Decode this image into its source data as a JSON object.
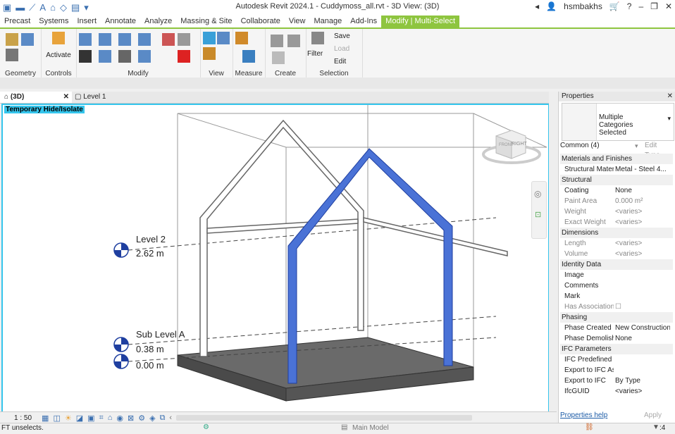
{
  "titlebar": {
    "title": "Autodesk Revit 2024.1 - Cuddymoss_all.rvt - 3D View: (3D)",
    "user": "hsmbakhs"
  },
  "tabs": [
    "Precast",
    "Systems",
    "Insert",
    "Annotate",
    "Analyze",
    "Massing & Site",
    "Collaborate",
    "View",
    "Manage",
    "Add-Ins",
    "Modify | Multi-Select"
  ],
  "ribbon": {
    "panels": [
      "Geometry",
      "Controls",
      "Modify",
      "View",
      "Measure",
      "Create",
      "Selection"
    ],
    "activate_label": "Activate",
    "filter_label": "Filter",
    "save_label": "Save",
    "load_label": "Load",
    "edit_label": "Edit"
  },
  "viewtabs": [
    "(3D)",
    "Level 1"
  ],
  "canvas": {
    "temp_hide": "Temporary Hide/Isolate",
    "levels": [
      {
        "name": "Level 2",
        "elev": "2.62 m"
      },
      {
        "name": "Sub Level A",
        "elev": "0.38 m"
      },
      {
        "name": "",
        "elev": "0.00 m"
      }
    ],
    "viewcube_faces": [
      "FRONT",
      "RIGHT"
    ]
  },
  "viewbar": {
    "scale": "1 : 50"
  },
  "status": {
    "text": "FT unselects.",
    "model": "Main Model",
    "filter_count": ":4"
  },
  "properties": {
    "title": "Properties",
    "type_name": "Multiple Categories Selected",
    "filter": "Common (4)",
    "edit_type": "Edit Type",
    "sections": [
      {
        "name": "Materials and Finishes",
        "rows": [
          {
            "k": "Structural Mater...",
            "v": "Metal - Steel 4...",
            "dim": false
          }
        ]
      },
      {
        "name": "Structural",
        "rows": [
          {
            "k": "Coating",
            "v": "None",
            "dim": false
          },
          {
            "k": "Paint Area",
            "v": "0.000 m²",
            "dim": true
          },
          {
            "k": "Weight",
            "v": "<varies>",
            "dim": true
          },
          {
            "k": "Exact Weight",
            "v": "<varies>",
            "dim": true
          }
        ]
      },
      {
        "name": "Dimensions",
        "rows": [
          {
            "k": "Length",
            "v": "<varies>",
            "dim": true
          },
          {
            "k": "Volume",
            "v": "<varies>",
            "dim": true
          }
        ]
      },
      {
        "name": "Identity Data",
        "rows": [
          {
            "k": "Image",
            "v": "",
            "dim": false
          },
          {
            "k": "Comments",
            "v": "",
            "dim": false
          },
          {
            "k": "Mark",
            "v": "",
            "dim": false
          },
          {
            "k": "Has Association",
            "v": "☐",
            "dim": true
          }
        ]
      },
      {
        "name": "Phasing",
        "rows": [
          {
            "k": "Phase Created",
            "v": "New Construction",
            "dim": false
          },
          {
            "k": "Phase Demolish...",
            "v": "None",
            "dim": false
          }
        ]
      },
      {
        "name": "IFC Parameters",
        "rows": [
          {
            "k": "IFC Predefined ...",
            "v": "",
            "dim": false
          },
          {
            "k": "Export to IFC As",
            "v": "",
            "dim": false
          },
          {
            "k": "Export to IFC",
            "v": "By Type",
            "dim": false
          },
          {
            "k": "IfcGUID",
            "v": "<varies>",
            "dim": false
          }
        ]
      }
    ],
    "help": "Properties help",
    "apply": "Apply"
  }
}
